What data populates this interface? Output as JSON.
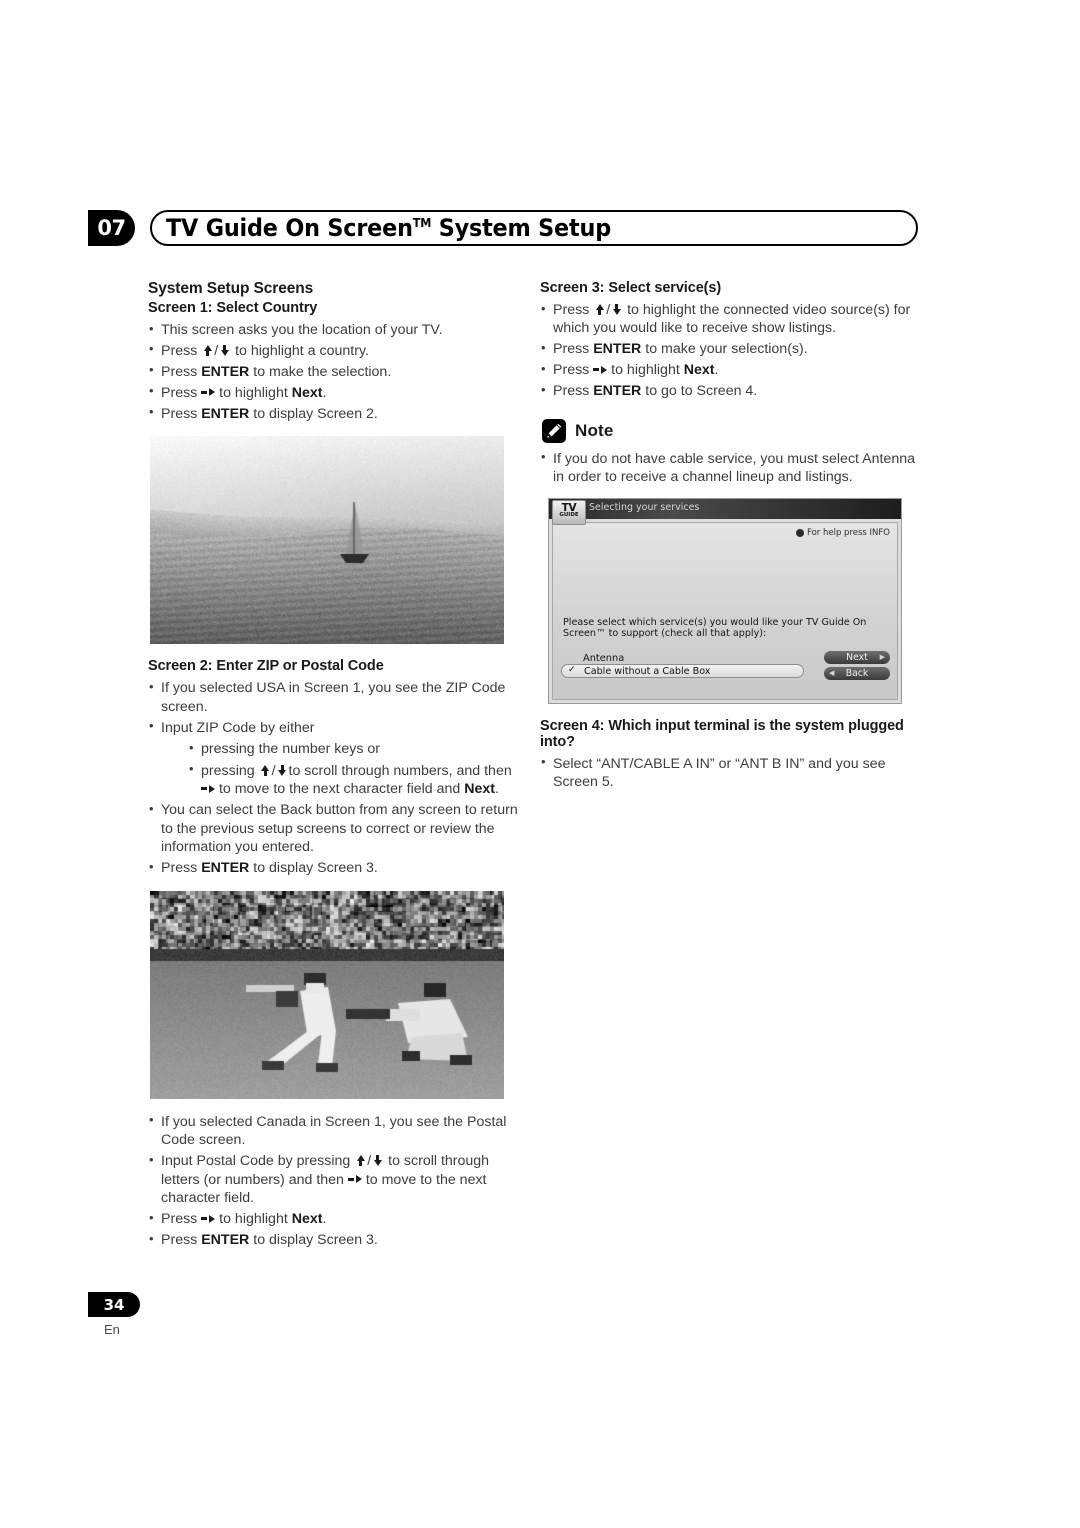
{
  "header": {
    "chapter_number": "07",
    "title_prefix": "TV Guide On Screen",
    "title_tm": "TM",
    "title_suffix": " System Setup"
  },
  "left_column": {
    "section_title": "System Setup Screens",
    "screen1": {
      "heading": "Screen 1: Select Country",
      "bullets": [
        "This screen asks you the location of your TV.",
        "Press ▲/▼ to highlight a country.",
        "Press ENTER to make the selection.",
        "Press ▶ to highlight Next.",
        "Press ENTER to display Screen 2."
      ]
    },
    "photo1": {
      "alt": "Grayscale photo of a sailboat on water with hills in background"
    },
    "screen2": {
      "heading": "Screen 2: Enter ZIP or Postal Code",
      "bullets": [
        "If you selected USA in Screen 1, you see the ZIP Code screen.",
        "Input ZIP Code by either",
        "You can select the Back button from any screen to return to the previous setup screens to correct or review the information you entered.",
        "Press ENTER to display Screen 3."
      ],
      "sub_bullets": [
        "pressing the number keys or",
        "pressing ▲/▼ to scroll through numbers, and then ▶ to move to the next character field and Next."
      ]
    },
    "photo2": {
      "alt": "Grayscale photo of a baseball game, pitcher and runner"
    },
    "canada": {
      "bullets": [
        "If you selected Canada in Screen 1, you see the Postal Code screen.",
        "Input Postal Code by pressing ▲/▼ to scroll through letters (or numbers) and then ▶ to move to the next character field.",
        "Press ▶ to highlight Next.",
        "Press ENTER to display Screen 3."
      ]
    }
  },
  "right_column": {
    "screen3": {
      "heading": "Screen 3: Select service(s)",
      "bullets": [
        "Press ▲/▼ to highlight the connected video source(s) for which you would like to receive show listings.",
        "Press ENTER to make your selection(s).",
        "Press ▶ to highlight Next.",
        "Press ENTER to go to Screen 4."
      ]
    },
    "note": {
      "label": "Note",
      "icon": "pencil-icon",
      "bullets": [
        "If you do not have cable service, you must select Antenna in order to receive a channel lineup and listings."
      ]
    },
    "tvgos_screenshot": {
      "logo_line1": "TV",
      "logo_line2": "GUIDE",
      "window_title": "Selecting your services",
      "help_text": "For help press INFO",
      "prompt": "Please select which service(s) you would like your TV Guide On Screen™ to support (check all that apply):",
      "option_antenna": "Antenna",
      "option_cable": "Cable without a Cable Box",
      "option_cable_checked": true,
      "check_glyph": "✓",
      "button_next": "Next",
      "button_back": "Back",
      "next_caret": "▶",
      "back_caret": "◀"
    },
    "screen4": {
      "heading": "Screen 4: Which input terminal is the system plugged into?",
      "bullets": [
        "Select “ANT/CABLE A IN” or “ANT B IN” and you see Screen 5."
      ]
    }
  },
  "footer": {
    "page_number": "34",
    "language": "En"
  },
  "colors": {
    "ink": "#231f20",
    "body_text": "#3d3d3d",
    "badge_bg": "#000000"
  }
}
